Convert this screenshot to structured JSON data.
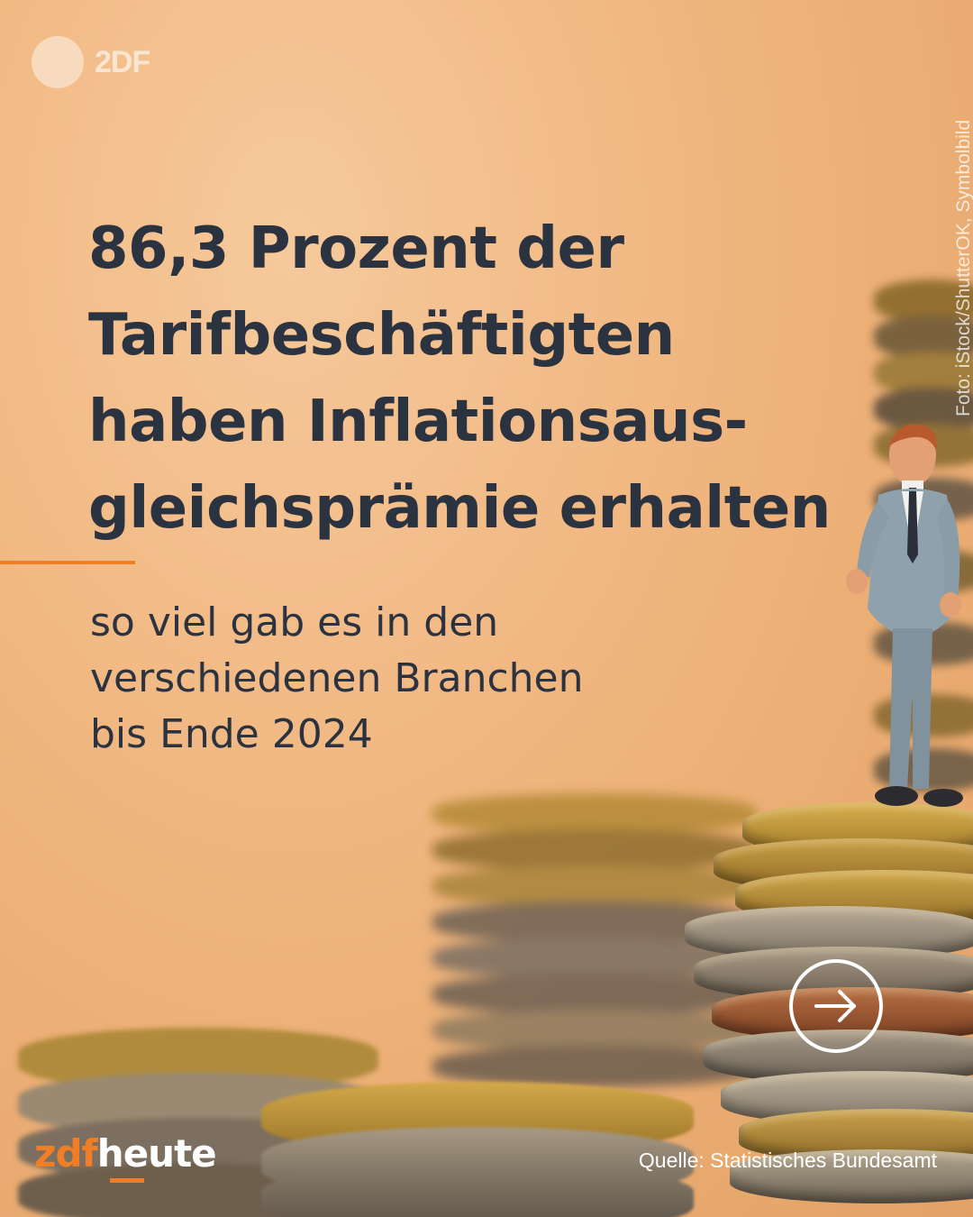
{
  "logo": {
    "text": "2DF"
  },
  "photo_credit": "Foto: iStock/ShutterOK, Symbolbild",
  "headline": "86,3 Prozent der Tarifbeschäftigten haben Inflationsausgleichsprämie erhalten",
  "headline_lines": [
    "86,3 Prozent der",
    "Tarifbeschäftigten",
    "haben Inflationsaus-",
    "gleichsprämie erhalten"
  ],
  "subline_lines": [
    "so viel gab es in den",
    "verschiedenen Branchen",
    "bis Ende 2024"
  ],
  "brand": {
    "part1": "zdf",
    "part2": "heute"
  },
  "source": "Quelle: Statistisches Bundesamt",
  "colors": {
    "accent": "#f07e26",
    "text": "#2b3240",
    "background": "#f0b57e"
  },
  "icons": {
    "next": "arrow-right-circle-icon"
  }
}
